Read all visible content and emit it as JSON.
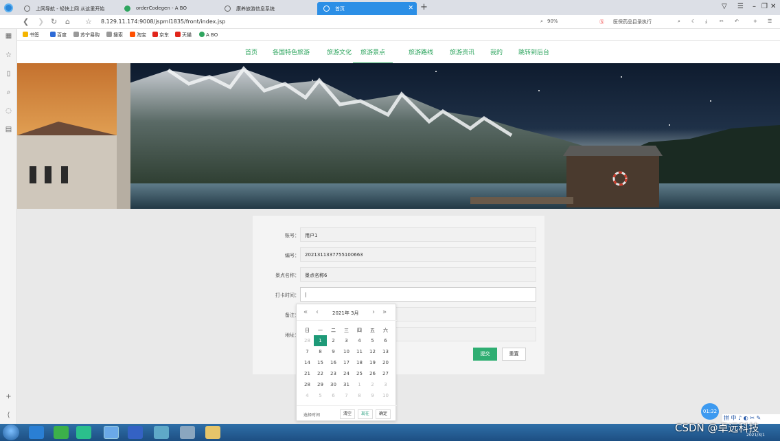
{
  "browser": {
    "tabs": [
      {
        "label": "上网导航 - 轻快上网 从这里开始",
        "active": false
      },
      {
        "label": "orderCodegen - A BO",
        "active": false
      },
      {
        "label": "康养旅游信息系统",
        "active": false
      },
      {
        "label": "首页",
        "active": true
      }
    ],
    "url": "8.129.11.174:9008/jspml1835/front/index.jsp",
    "zoom": "90%",
    "news_text": "医保药品目录执行",
    "bookmarks": [
      "书签",
      "百度",
      "苏宁易购",
      "搜索",
      "淘宝",
      "京东",
      "天猫",
      "A BO"
    ]
  },
  "nav": {
    "items": [
      "首页",
      "各国特色旅游",
      "旅游文化",
      "旅游景点",
      "旅游路线",
      "旅游资讯",
      "我的",
      "跳转到后台"
    ],
    "active_index": 3
  },
  "form": {
    "fields": [
      {
        "label": "账号：",
        "value": "用户1"
      },
      {
        "label": "编号：",
        "value": "2021311337755100663"
      },
      {
        "label": "景点名称：",
        "value": "景点名称6"
      },
      {
        "label": "打卡时间：",
        "value": "|"
      },
      {
        "label": "备注：",
        "value": ""
      },
      {
        "label": "地址：",
        "value": ""
      }
    ],
    "submit_label": "提交",
    "reset_label": "重置"
  },
  "calendar": {
    "year_month": "2021年  3月",
    "weekdays": [
      "日",
      "一",
      "二",
      "三",
      "四",
      "五",
      "六"
    ],
    "weeks": [
      [
        "28",
        "1",
        "2",
        "3",
        "4",
        "5",
        "6"
      ],
      [
        "7",
        "8",
        "9",
        "10",
        "11",
        "12",
        "13"
      ],
      [
        "14",
        "15",
        "16",
        "17",
        "18",
        "19",
        "20"
      ],
      [
        "21",
        "22",
        "23",
        "24",
        "25",
        "26",
        "27"
      ],
      [
        "28",
        "29",
        "30",
        "31",
        "1",
        "2",
        "3"
      ],
      [
        "4",
        "5",
        "6",
        "7",
        "8",
        "9",
        "10"
      ]
    ],
    "selected": "1",
    "select_time_label": "选择时间",
    "clear_label": "清空",
    "now_label": "现在",
    "confirm_label": "确定"
  },
  "clock_bubble": "01:32",
  "watermark": "CSDN @卓远科技",
  "taskbar": {
    "date": "2021/3/1",
    "ime": "拼 中 ♪ ◐ ✂ ✎"
  },
  "colors": {
    "accent": "#2fa55f",
    "tab_active": "#2c8fe6",
    "calendar_selected": "#1e9a78",
    "submit": "#2fae72"
  }
}
